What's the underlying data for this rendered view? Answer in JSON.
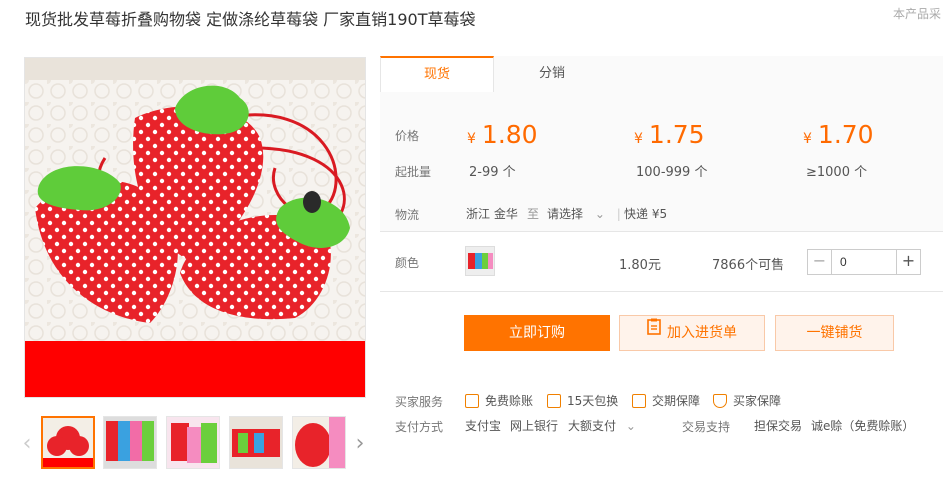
{
  "title": "现货批发草莓折叠购物袋 定做涤纶草莓袋 厂家直销190T草莓袋",
  "corner_text": "本产品采",
  "tabs": [
    {
      "label": "现货"
    },
    {
      "label": "分销"
    }
  ],
  "price_label": "价格",
  "moq_label": "起批量",
  "currency": "¥",
  "prices": [
    {
      "price": "1.80",
      "range": "2-99 个"
    },
    {
      "price": "1.75",
      "range": "100-999 个"
    },
    {
      "price": "1.70",
      "range": "≥1000 个"
    }
  ],
  "logistics": {
    "label": "物流",
    "origin": "浙江 金华",
    "to": "至",
    "destination": "请选择",
    "shipping": "快递 ¥5"
  },
  "color": {
    "label": "颜色",
    "price": "1.80元",
    "stock": "7866个可售",
    "quantity": "0"
  },
  "actions": {
    "buy": "立即订购",
    "cart": "加入进货单",
    "distribute": "一键铺货"
  },
  "services": {
    "label": "买家服务",
    "items": [
      "免费赊账",
      "15天包换",
      "交期保障",
      "买家保障"
    ]
  },
  "payment": {
    "label": "支付方式",
    "methods": [
      "支付宝",
      "网上银行",
      "大额支付"
    ],
    "trade_label": "交易支持",
    "trade_items": [
      "担保交易",
      "诚e赊（免费赊账）"
    ]
  },
  "colors": {
    "accent": "#ff7300",
    "price": "#ff6a00",
    "strawberry": "#e8232a",
    "leaf": "#5fcc3a",
    "banner": "#ff0000"
  }
}
